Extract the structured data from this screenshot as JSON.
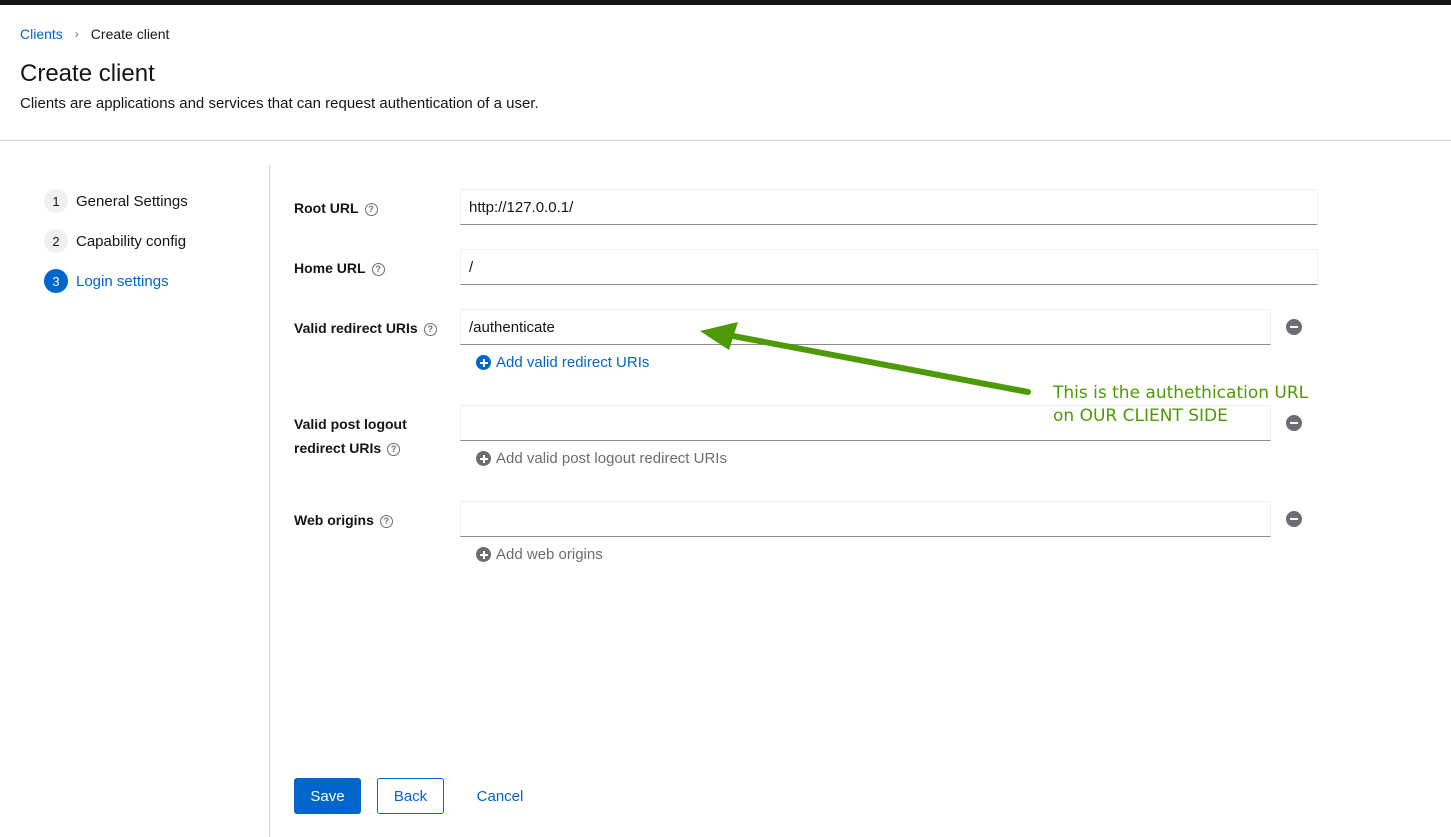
{
  "breadcrumb": {
    "parent": "Clients",
    "current": "Create client"
  },
  "page": {
    "title": "Create client",
    "description": "Clients are applications and services that can request authentication of a user."
  },
  "wizard": {
    "steps": [
      {
        "number": "1",
        "label": "General Settings",
        "active": false
      },
      {
        "number": "2",
        "label": "Capability config",
        "active": false
      },
      {
        "number": "3",
        "label": "Login settings",
        "active": true
      }
    ]
  },
  "form": {
    "root_url": {
      "label": "Root URL",
      "value": "http://127.0.0.1/"
    },
    "home_url": {
      "label": "Home URL",
      "value": "/"
    },
    "valid_redirect_uris": {
      "label": "Valid redirect URIs",
      "value": "/authenticate",
      "add_label": "Add valid redirect URIs"
    },
    "valid_post_logout": {
      "label_line1": "Valid post logout",
      "label_line2": "redirect URIs",
      "value": "",
      "add_label": "Add valid post logout redirect URIs"
    },
    "web_origins": {
      "label": "Web origins",
      "value": "",
      "add_label": "Add web origins"
    },
    "help_glyph": "?"
  },
  "annotation": {
    "line1": "This is the authethication URL",
    "line2": "on OUR CLIENT SIDE",
    "color": "#4e9a06"
  },
  "actions": {
    "save": "Save",
    "back": "Back",
    "cancel": "Cancel"
  },
  "colors": {
    "primary": "#0066cc",
    "text": "#151515",
    "muted": "#6a6e73"
  }
}
